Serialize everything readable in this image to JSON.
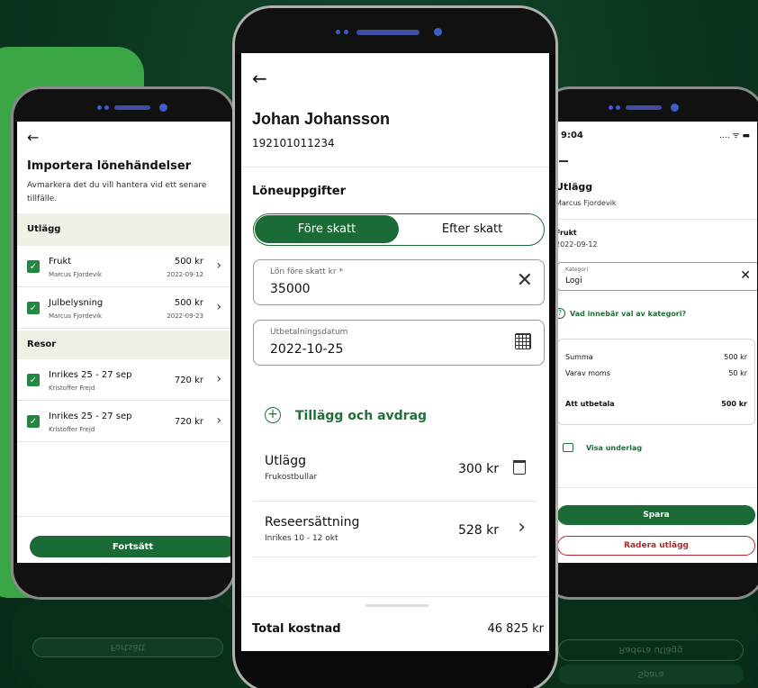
{
  "left": {
    "title": "Importera lönehändelser",
    "subtitle": "Avmarkera det du vill hantera vid ett senare tillfälle.",
    "sections": [
      {
        "label": "Utlägg",
        "items": [
          {
            "name": "Frukt",
            "person": "Marcus Fjordevik",
            "amount": "500 kr",
            "date": "2022-09-12"
          },
          {
            "name": "Julbelysning",
            "person": "Marcus Fjordevik",
            "amount": "500 kr",
            "date": "2022-09-23"
          }
        ]
      },
      {
        "label": "Resor",
        "items": [
          {
            "name": "Inrikes 25 - 27 sep",
            "person": "Kristoffer Frejd",
            "amount": "720 kr",
            "date": ""
          },
          {
            "name": "Inrikes 25 - 27 sep",
            "person": "Kristoffer Frejd",
            "amount": "720 kr",
            "date": ""
          }
        ]
      }
    ],
    "continue_label": "Fortsätt"
  },
  "center": {
    "name": "Johan Johansson",
    "personal_number": "192101011234",
    "section_title": "Löneuppgifter",
    "tabs": [
      "Före skatt",
      "Efter skatt"
    ],
    "salary_label": "Lön före skatt kr *",
    "salary_value": "35000",
    "date_label": "Utbetalningsdatum",
    "date_value": "2022-10-25",
    "add_label": "Tillägg och avdrag",
    "items": [
      {
        "title": "Utlägg",
        "sub": "Frukostbullar",
        "amount": "300 kr"
      },
      {
        "title": "Reseersättning",
        "sub": "Inrikes 10 - 12 okt",
        "amount": "528 kr"
      }
    ],
    "total_label": "Total kostnad",
    "total_value": "46 825 kr"
  },
  "right": {
    "time": "9:04",
    "title": "Utlägg",
    "person": "Marcus Fjordevik",
    "item_name": "Frukt",
    "item_date": "2022-09-12",
    "category_label": "Kategori",
    "category_value": "Logi",
    "help_text": "Vad innebär val av kategori?",
    "summary": [
      {
        "label": "Summa",
        "value": "500 kr"
      },
      {
        "label": "Varav moms",
        "value": "50 kr"
      }
    ],
    "payout_label": "Att utbetala",
    "payout_value": "500 kr",
    "attachment_label": "Visa underlag",
    "save_label": "Spara",
    "delete_label": "Radera utlägg"
  },
  "reflections": {
    "left": "Fortsätt",
    "right": "Radera utlägg",
    "right2": "Spara"
  },
  "colors": {
    "primary": "#1a6b35",
    "accent": "#3aa646",
    "danger": "#b3262d",
    "background": "#0d3a22"
  }
}
